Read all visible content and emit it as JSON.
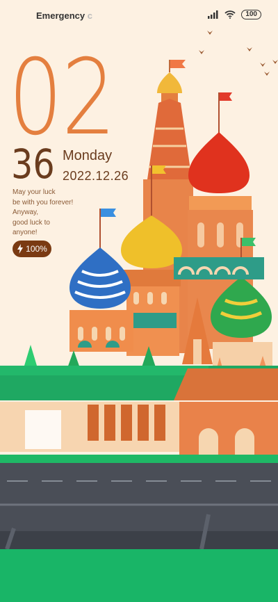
{
  "status_bar": {
    "carrier": "Emergency",
    "carrier_fade": "c",
    "battery": "100"
  },
  "clock": {
    "hours": "02",
    "minutes": "36"
  },
  "date": {
    "day": "Monday",
    "full": "2022.12.26"
  },
  "message": {
    "line1": "May your luck",
    "line2": "be with you forever!",
    "line3": "Anyway,",
    "line4": "good luck to",
    "line5": "anyone!"
  },
  "battery_badge": {
    "text": "100%",
    "icon": "bolt-icon"
  },
  "colors": {
    "background": "#FDF1E2",
    "accent_orange": "#E47F3F",
    "accent_brown": "#6A3C1E",
    "grass": "#19B567",
    "road": "#4A4E57"
  }
}
